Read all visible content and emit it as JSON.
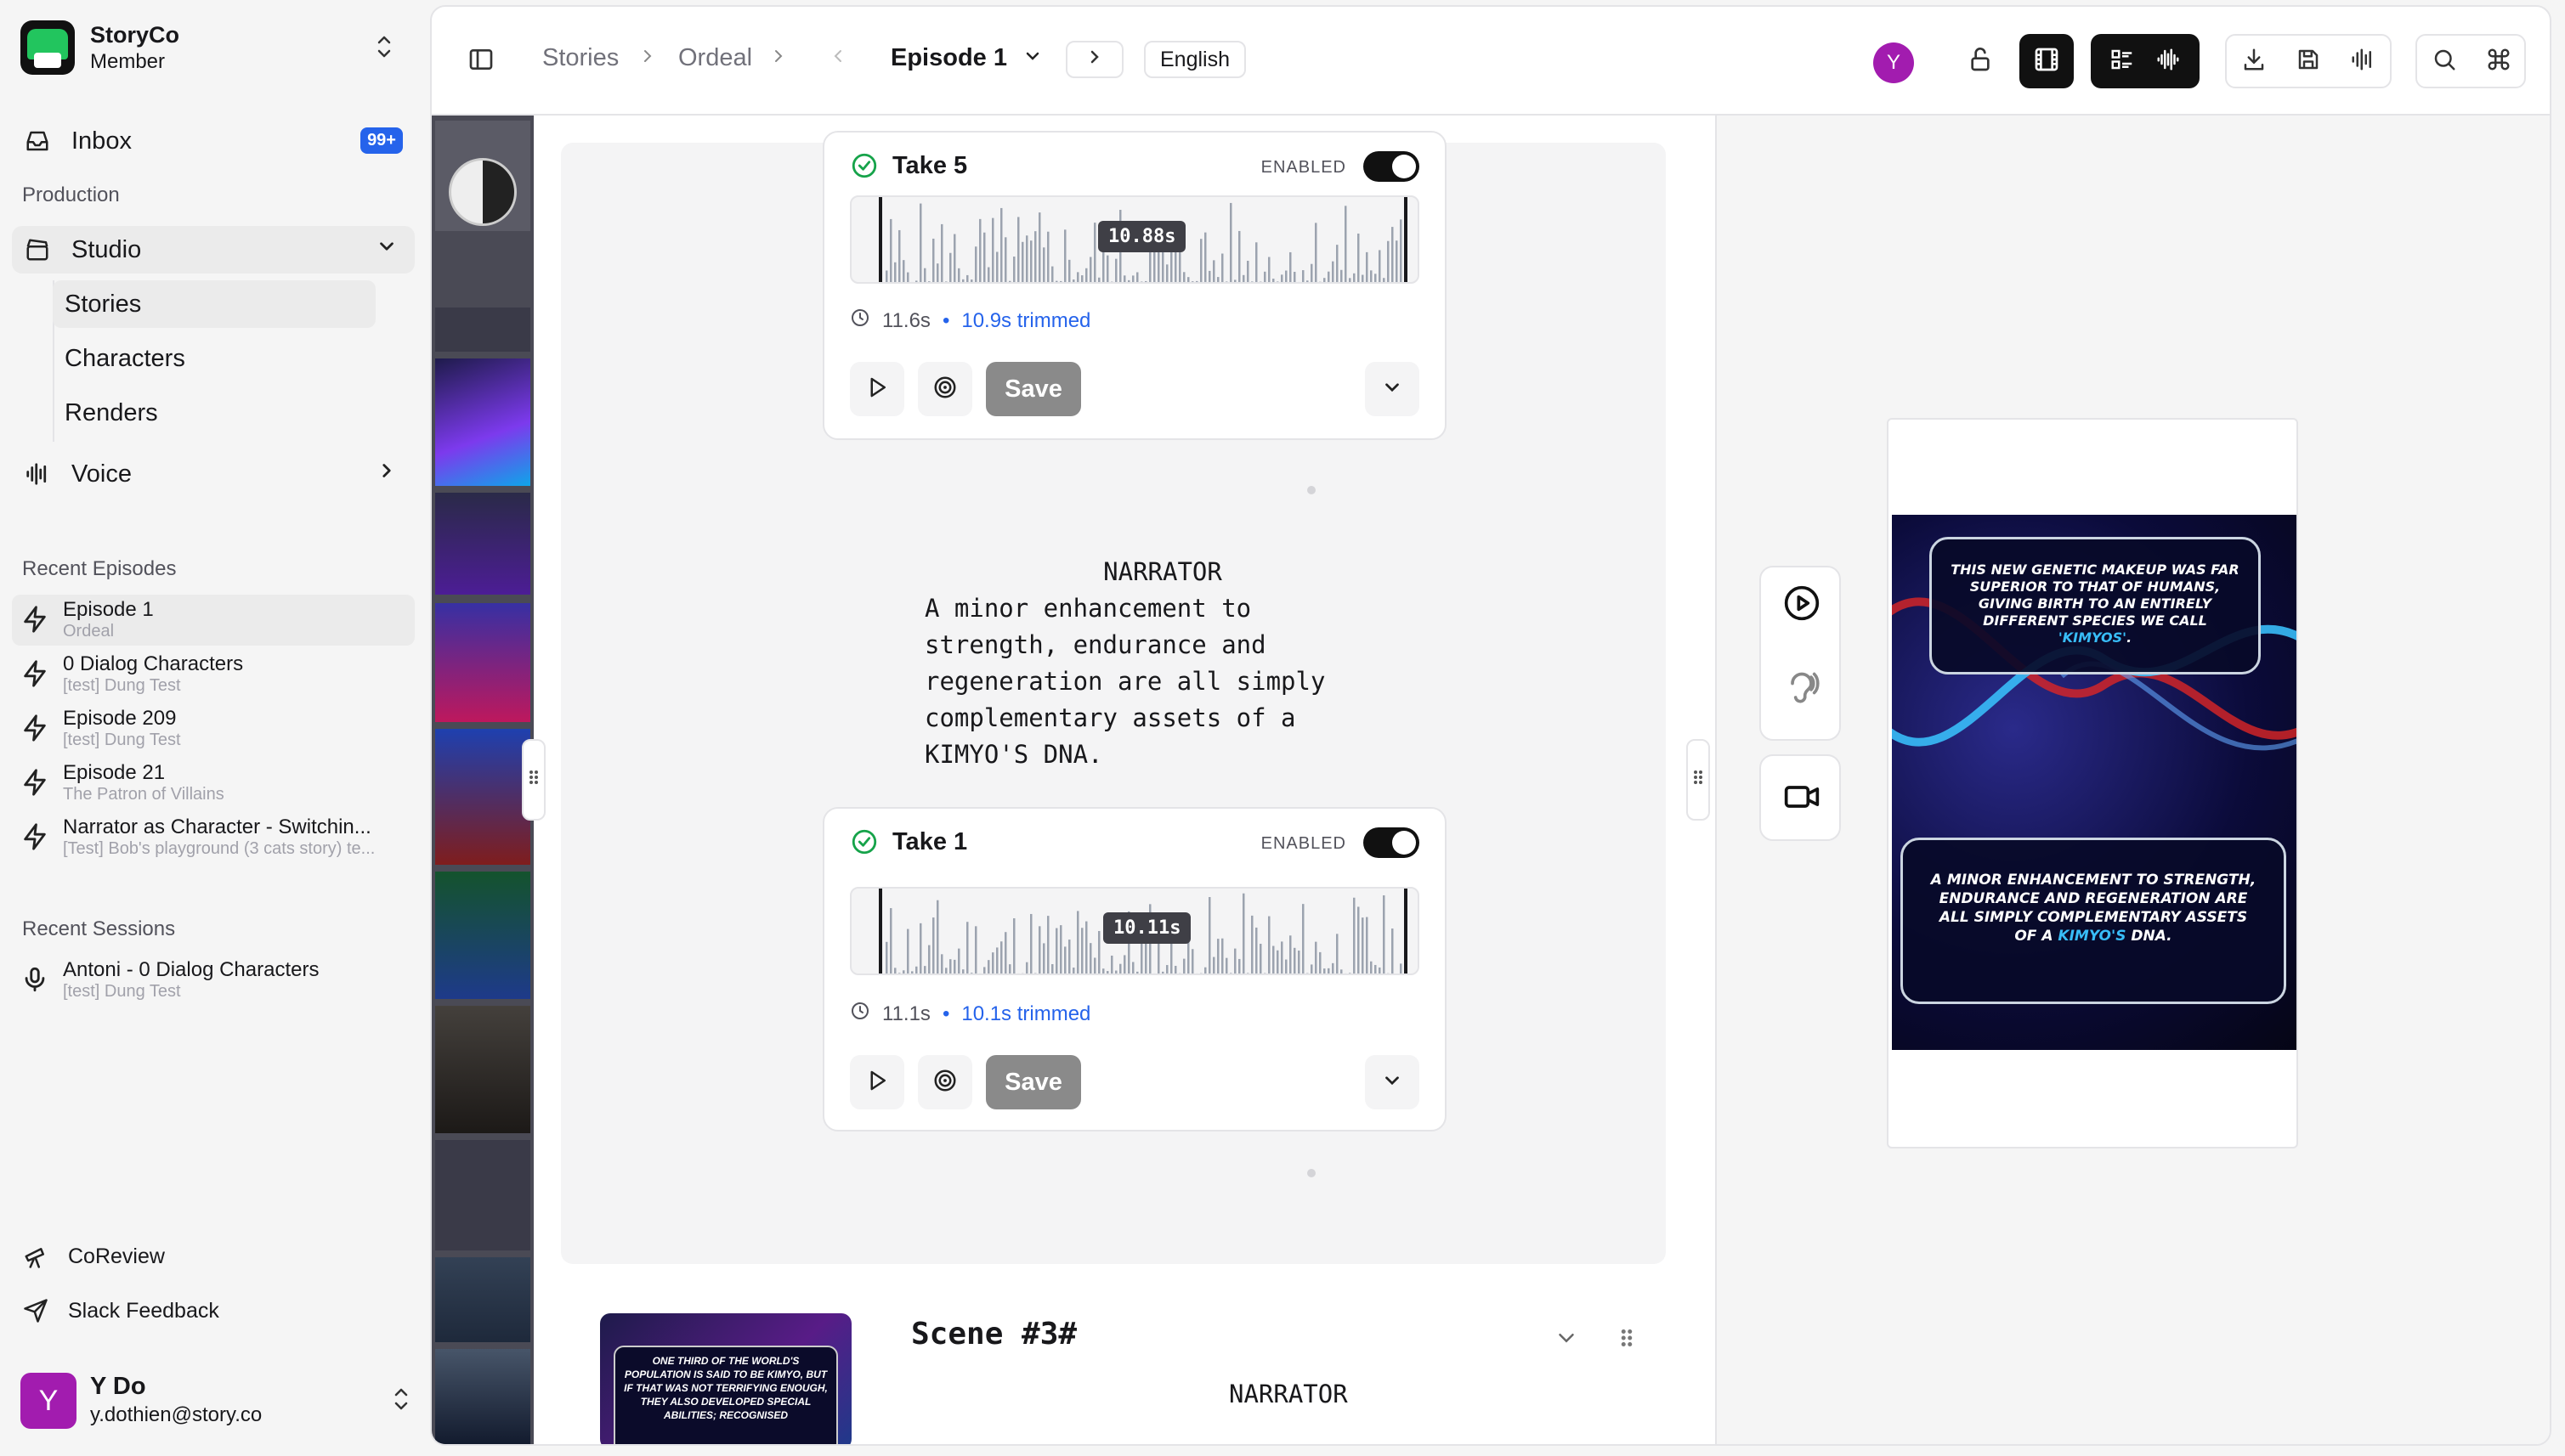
{
  "brand": {
    "name": "StoryCo",
    "role": "Member"
  },
  "nav": {
    "inbox": {
      "label": "Inbox",
      "badge": "99+"
    },
    "production_label": "Production",
    "studio": {
      "label": "Studio",
      "items": [
        "Stories",
        "Characters",
        "Renders"
      ]
    },
    "voice": {
      "label": "Voice"
    }
  },
  "recent_episodes": {
    "label": "Recent Episodes",
    "items": [
      {
        "title": "Episode 1",
        "sub": "Ordeal"
      },
      {
        "title": "0 Dialog Characters",
        "sub": "[test] Dung Test"
      },
      {
        "title": "Episode 209",
        "sub": "[test] Dung Test"
      },
      {
        "title": "Episode 21",
        "sub": "The Patron of Villains"
      },
      {
        "title": "Narrator as Character - Switchin...",
        "sub": "[Test] Bob's playground (3 cats story) te..."
      }
    ]
  },
  "recent_sessions": {
    "label": "Recent Sessions",
    "items": [
      {
        "title": "Antoni - 0 Dialog Characters",
        "sub": "[test] Dung Test"
      }
    ]
  },
  "footer": {
    "coreview": "CoReview",
    "slack": "Slack Feedback"
  },
  "user": {
    "initial": "Y",
    "name": "Y Do",
    "email": "y.dothien@story.co"
  },
  "topbar": {
    "crumb1": "Stories",
    "crumb2": "Ordeal",
    "episode": "Episode 1",
    "language": "English",
    "avatar": "Y"
  },
  "takes": [
    {
      "label": "Take 5",
      "enabled": "ENABLED",
      "duration_tag": "10.88s",
      "length": "11.6s",
      "trimmed": "10.9s trimmed",
      "save": "Save"
    },
    {
      "label": "Take 1",
      "enabled": "ENABLED",
      "duration_tag": "10.11s",
      "length": "11.1s",
      "trimmed": "10.1s trimmed",
      "save": "Save"
    }
  ],
  "dialog": {
    "speaker": "NARRATOR",
    "lines": [
      "A minor enhancement to",
      "strength, endurance and",
      "regeneration are all simply",
      "complementary assets of a",
      "KIMYO'S DNA."
    ]
  },
  "scene": {
    "title": "Scene  #3#",
    "speaker": "NARRATOR",
    "thumb_text": "ONE THIRD OF THE WORLD'S POPULATION IS SAID TO BE KIMYO, BUT IF THAT WAS NOT TERRIFYING ENOUGH, THEY ALSO DEVELOPED SPECIAL ABILITIES; RECOGNISED"
  },
  "preview": {
    "box1_a": "THIS NEW GENETIC MAKEUP WAS FAR SUPERIOR TO THAT OF HUMANS, GIVING BIRTH TO AN ENTIRELY DIFFERENT SPECIES WE CALL ",
    "box1_hl": "'KIMYOS'",
    "box1_b": ".",
    "box2_a": "A MINOR ENHANCEMENT TO STRENGTH, ENDURANCE AND REGENERATION ARE ALL SIMPLY COMPLEMENTARY ASSETS OF A ",
    "box2_hl": "KIMYO'S",
    "box2_b": " DNA."
  },
  "colors": {
    "accent": "#2563eb",
    "success": "#16a34a",
    "dark": "#111111"
  }
}
